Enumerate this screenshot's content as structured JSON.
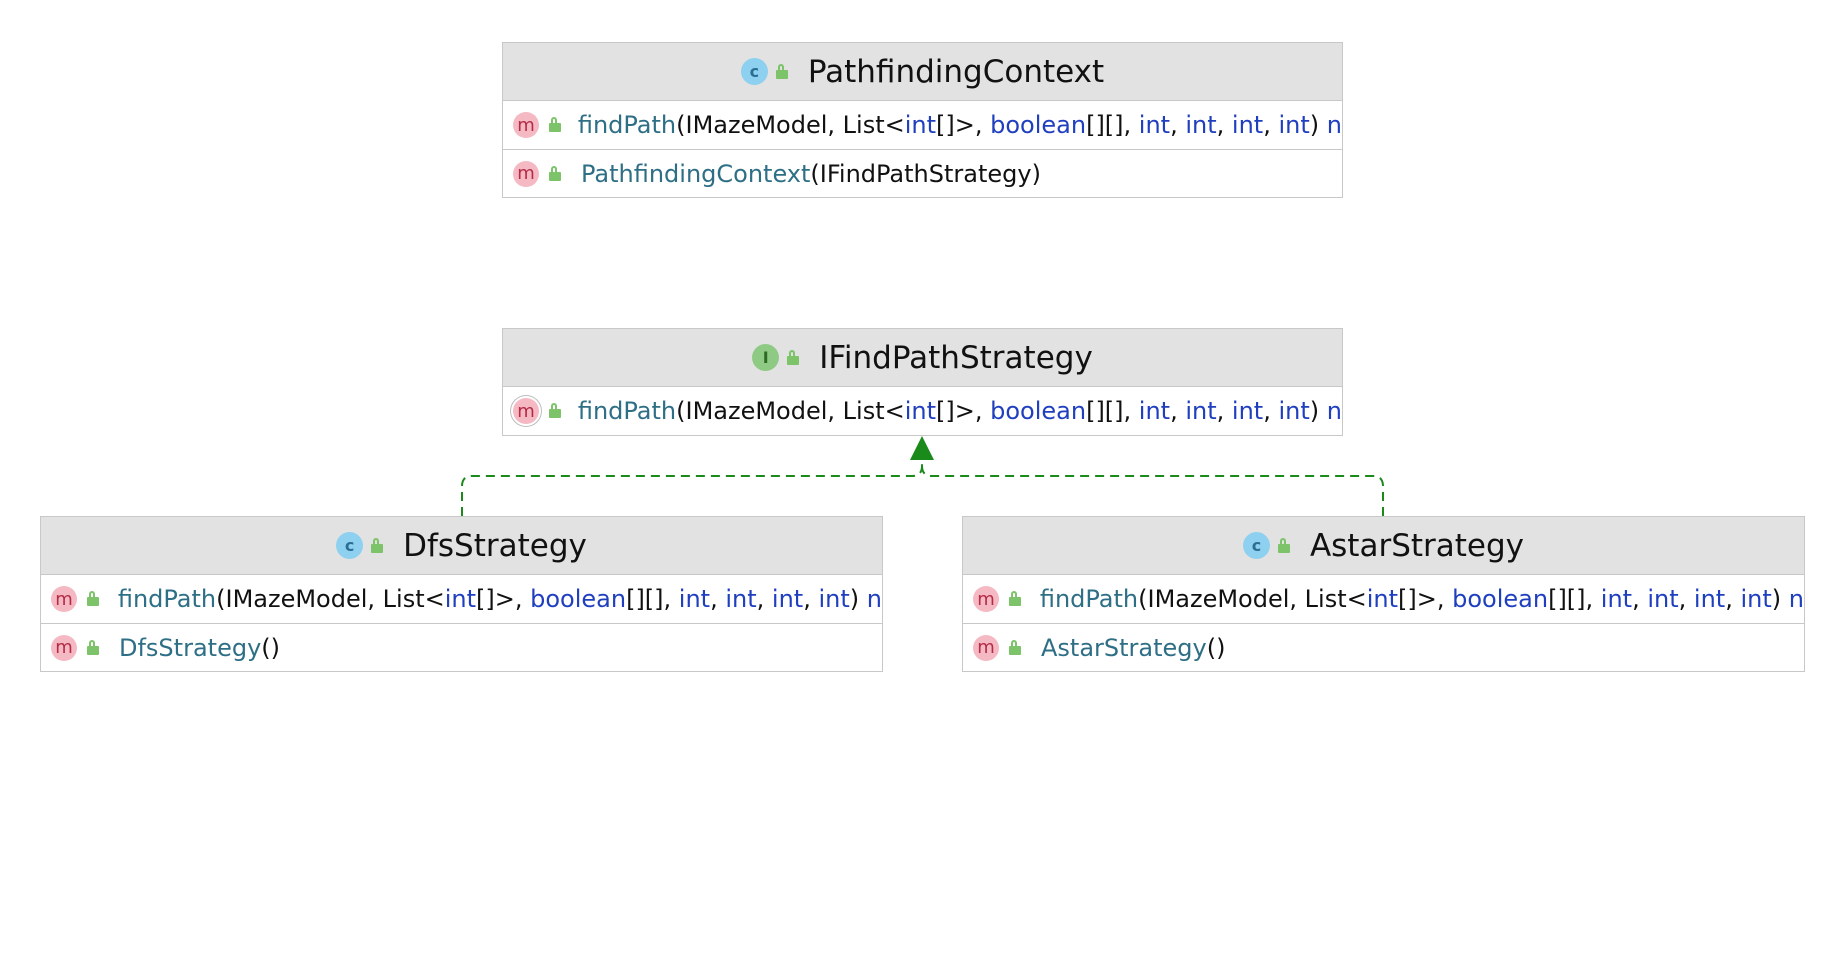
{
  "classes": [
    {
      "id": "pathfinding-context",
      "kind": "class",
      "kind_letter": "c",
      "name": "PathfindingContext",
      "methods": [
        {
          "abstract": false,
          "icon_letter": "m",
          "name": "findPath",
          "tokens": [
            {
              "t": "(IMazeModel, List<",
              "c": "plain"
            },
            {
              "t": "int",
              "c": "kw"
            },
            {
              "t": "[]>, ",
              "c": "plain"
            },
            {
              "t": "boolean",
              "c": "kw"
            },
            {
              "t": "[][], ",
              "c": "plain"
            },
            {
              "t": "int",
              "c": "kw"
            },
            {
              "t": ", ",
              "c": "plain"
            },
            {
              "t": "int",
              "c": "kw"
            },
            {
              "t": ", ",
              "c": "plain"
            },
            {
              "t": "int",
              "c": "kw"
            },
            {
              "t": ", ",
              "c": "plain"
            },
            {
              "t": "int",
              "c": "kw"
            },
            {
              "t": ") ",
              "c": "plain"
            },
            {
              "t": "n",
              "c": "kw"
            }
          ]
        },
        {
          "abstract": false,
          "icon_letter": "m",
          "name": "PathfindingContext",
          "tokens": [
            {
              "t": "(IFindPathStrategy)",
              "c": "plain"
            }
          ]
        }
      ]
    },
    {
      "id": "ifindpath-strategy",
      "kind": "interface",
      "kind_letter": "I",
      "name": "IFindPathStrategy",
      "methods": [
        {
          "abstract": true,
          "icon_letter": "m",
          "name": "findPath",
          "tokens": [
            {
              "t": "(IMazeModel, List<",
              "c": "plain"
            },
            {
              "t": "int",
              "c": "kw"
            },
            {
              "t": "[]>, ",
              "c": "plain"
            },
            {
              "t": "boolean",
              "c": "kw"
            },
            {
              "t": "[][], ",
              "c": "plain"
            },
            {
              "t": "int",
              "c": "kw"
            },
            {
              "t": ", ",
              "c": "plain"
            },
            {
              "t": "int",
              "c": "kw"
            },
            {
              "t": ", ",
              "c": "plain"
            },
            {
              "t": "int",
              "c": "kw"
            },
            {
              "t": ", ",
              "c": "plain"
            },
            {
              "t": "int",
              "c": "kw"
            },
            {
              "t": ") ",
              "c": "plain"
            },
            {
              "t": "n",
              "c": "kw"
            }
          ]
        }
      ]
    },
    {
      "id": "dfs-strategy",
      "kind": "class",
      "kind_letter": "c",
      "name": "DfsStrategy",
      "methods": [
        {
          "abstract": false,
          "icon_letter": "m",
          "name": "findPath",
          "tokens": [
            {
              "t": "(IMazeModel, List<",
              "c": "plain"
            },
            {
              "t": "int",
              "c": "kw"
            },
            {
              "t": "[]>, ",
              "c": "plain"
            },
            {
              "t": "boolean",
              "c": "kw"
            },
            {
              "t": "[][], ",
              "c": "plain"
            },
            {
              "t": "int",
              "c": "kw"
            },
            {
              "t": ", ",
              "c": "plain"
            },
            {
              "t": "int",
              "c": "kw"
            },
            {
              "t": ", ",
              "c": "plain"
            },
            {
              "t": "int",
              "c": "kw"
            },
            {
              "t": ", ",
              "c": "plain"
            },
            {
              "t": "int",
              "c": "kw"
            },
            {
              "t": ") ",
              "c": "plain"
            },
            {
              "t": "n",
              "c": "kw"
            }
          ]
        },
        {
          "abstract": false,
          "icon_letter": "m",
          "name": "DfsStrategy",
          "tokens": [
            {
              "t": "()",
              "c": "plain"
            }
          ]
        }
      ]
    },
    {
      "id": "astar-strategy",
      "kind": "class",
      "kind_letter": "c",
      "name": "AstarStrategy",
      "methods": [
        {
          "abstract": false,
          "icon_letter": "m",
          "name": "findPath",
          "tokens": [
            {
              "t": "(IMazeModel, List<",
              "c": "plain"
            },
            {
              "t": "int",
              "c": "kw"
            },
            {
              "t": "[]>, ",
              "c": "plain"
            },
            {
              "t": "boolean",
              "c": "kw"
            },
            {
              "t": "[][], ",
              "c": "plain"
            },
            {
              "t": "int",
              "c": "kw"
            },
            {
              "t": ", ",
              "c": "plain"
            },
            {
              "t": "int",
              "c": "kw"
            },
            {
              "t": ", ",
              "c": "plain"
            },
            {
              "t": "int",
              "c": "kw"
            },
            {
              "t": ", ",
              "c": "plain"
            },
            {
              "t": "int",
              "c": "kw"
            },
            {
              "t": ") ",
              "c": "plain"
            },
            {
              "t": "n",
              "c": "kw"
            }
          ]
        },
        {
          "abstract": false,
          "icon_letter": "m",
          "name": "AstarStrategy",
          "tokens": [
            {
              "t": "()",
              "c": "plain"
            }
          ]
        }
      ]
    }
  ],
  "relations": [
    {
      "type": "realization",
      "from": "dfs-strategy",
      "to": "ifindpath-strategy"
    },
    {
      "type": "realization",
      "from": "astar-strategy",
      "to": "ifindpath-strategy"
    }
  ],
  "colors": {
    "realization_arrow": "#1a8a1a",
    "header_bg": "#e2e2e2",
    "method_name": "#2e6f86",
    "keyword": "#1f3fbf",
    "method_icon_bg": "#f5b9c4",
    "class_icon_bg": "#8ed0ef",
    "interface_icon_bg": "#8fca85"
  }
}
